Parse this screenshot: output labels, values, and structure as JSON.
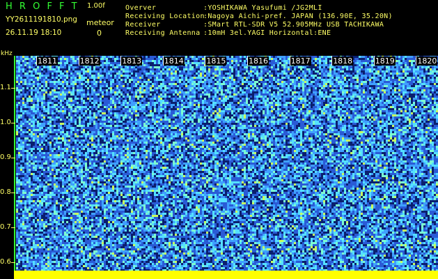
{
  "app": {
    "logo": "H R O F F T",
    "version": "1.00f",
    "filename": "YY2611191810.png",
    "datetime": "26.11.19 18:10",
    "meteor_label": "meteor",
    "meteor_count": "0"
  },
  "station": [
    {
      "key": "Overver",
      "value": ":YOSHIKAWA Yasufumi /JG2MLI"
    },
    {
      "key": "Receiving Location",
      "value": ":Nagoya Aichi-pref. JAPAN (136.90E, 35.20N)"
    },
    {
      "key": "Receiver",
      "value": ":SMart RTL-SDR V5 52.905MHz USB TACHIKAWA"
    },
    {
      "key": "Receiving Antenna",
      "value": ":10mH 3el.YAGI Horizontal:ENE"
    }
  ],
  "spectrogram": {
    "y_unit": "kHz",
    "y_ticks": [
      "1.1",
      "1.0",
      "0.9",
      "0.8",
      "0.7",
      "0.6"
    ],
    "time_labels": [
      "1811",
      "1812",
      "1813",
      "1814",
      "1815",
      "1816",
      "1817",
      "1818",
      "1819",
      "1820"
    ],
    "colors": {
      "background": "#1c3fa8",
      "noise": [
        "#0a1f6e",
        "#2a5bd6",
        "#3fa0ff",
        "#55e0ff",
        "#7dffd0",
        "#c8ff60"
      ],
      "floor": "#ffff00",
      "axis": "#33ff33",
      "label": "#ffff66"
    }
  }
}
